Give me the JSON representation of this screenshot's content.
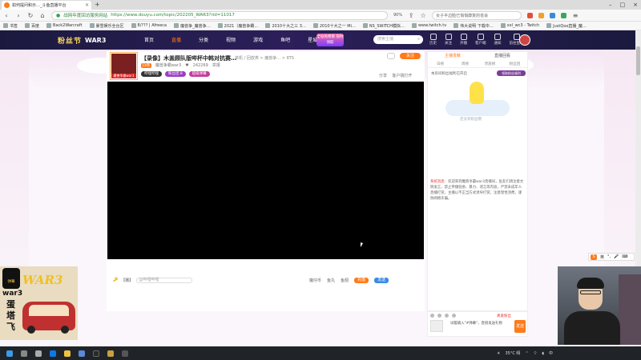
{
  "browser": {
    "tab_title": "如何提问和示…_斗鱼直播平台",
    "url_site": "战网年度回访服务网站",
    "url_full": "https://www.douyu.com/topic/202205_WAR3?rid=11017",
    "zoom": "90%",
    "search_box": "女子半边脸已悄悄康复的省会",
    "bookmarks": [
      "书签",
      "百度",
      "Back2Warcraft",
      "暴雪娱乐全台区",
      "8/??? | Afreeca",
      "魔兽争_魔兽争…",
      "2021（魔兽争霸…",
      "2010十大之三 3…",
      "2010十大之一 Mi…",
      "NS_SWITCH模拟…",
      "www.twitch.tv",
      "伟大说明 下载中…",
      "xxl_wc3 - Twitch",
      "JustQoo直播_魔…"
    ]
  },
  "site_header": {
    "logo_text": "粉丝节",
    "logo_sub": "WAR3",
    "nav": [
      "首页",
      "直播",
      "分类",
      "视频",
      "游戏",
      "鱼吧",
      "星城崛起"
    ],
    "active_nav": "直播",
    "promo": "全站免费看 限时领取",
    "search_placeholder": "搜索主播",
    "icons": [
      "历史",
      "关注",
      "开播",
      "客户端",
      "通知",
      "前往鱼吧"
    ],
    "fish_bar": "前往鱼吧"
  },
  "room": {
    "title": "【录像】木盖顾队版哔杯中韩对抗赛…",
    "category": "单机 / 回放类 > 魔兽争… > RTS",
    "level": "LV8",
    "streamer": "魔兽争霸war3",
    "followers": "242269",
    "report": "举报",
    "badges": [
      "哔哩哔哩",
      "粉丝团 8",
      "超级弹幕"
    ],
    "follow_btn": "关注",
    "share": "分享",
    "client_open": "客户端打开"
  },
  "video_bar": {
    "left_label": "【赛】",
    "input_placeholder": "@哔哩哔哩",
    "items": [
      "魔仔币",
      "鱼丸",
      "鱼翅"
    ],
    "btn_fill": "充值",
    "btn_send": "发送"
  },
  "side_panel": {
    "tabs": [
      "主播贡献",
      "直播回看"
    ],
    "subtabs": [
      "日榜",
      "周榜",
      "贵族榜",
      "粉丝团"
    ],
    "notice": "本房间粉丝福利已开启",
    "fan_btn": "领取粉丝福利",
    "mascot_caption": "还没有粉丝哦",
    "sys_label": "系统消息：",
    "sys_text": "欢迎来到魔兽争霸war3直播间，鱼友们请注意文明发言，禁止传播低俗、暴力、谣言等内容，严禁未成年人直播打赏，主播以不正当方式诱导打赏，注意理性消费，谨防网络诈骗。"
  },
  "side_foot": {
    "gift_label": "真爱粉丝",
    "text": "试着输入\"#弹幕\"，直接发送礼物",
    "send": "发送"
  },
  "ime": {
    "symbol": "S",
    "label": "英"
  },
  "overlay": {
    "badge": "弹幕",
    "war": "WAR3",
    "w3": "war3",
    "egg": "蛋塔飞"
  },
  "taskbar": {
    "weather": "35°C 晴",
    "ime_lang": "中",
    "time": ""
  }
}
